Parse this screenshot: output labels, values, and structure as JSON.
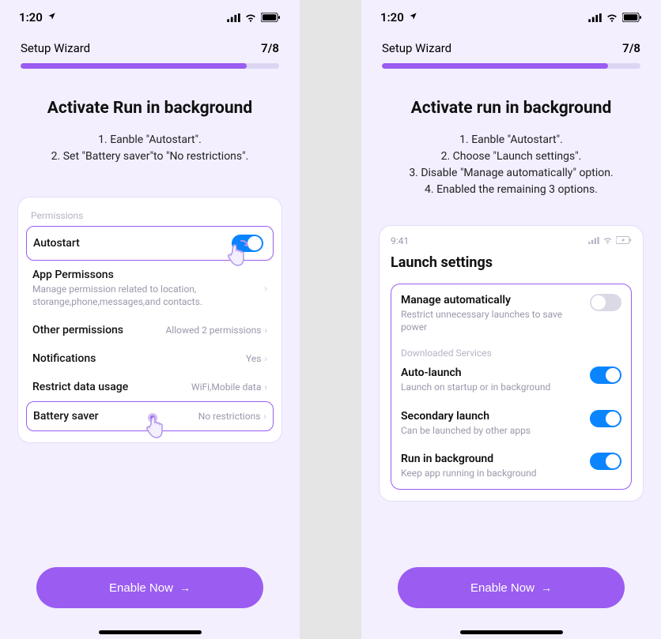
{
  "statusbar": {
    "time": "1:20"
  },
  "header": {
    "label": "Setup Wizard",
    "step": "7/8"
  },
  "left": {
    "title": "Activate Run in background",
    "instructions": [
      "1.  Eanble \"Autostart\".",
      "2.  Set \"Battery saver\"to \"No restrictions\"."
    ],
    "card": {
      "section": "Permissions",
      "autostart": {
        "label": "Autostart"
      },
      "apppermissions": {
        "label": "App Permissons",
        "sub": "Manage permission related to location, storange,phone,messages,and contacts."
      },
      "otherperm": {
        "label": "Other permissions",
        "value": "Allowed 2 permissions"
      },
      "notifications": {
        "label": "Notifications",
        "value": "Yes"
      },
      "restrictdata": {
        "label": "Restrict data usage",
        "value": "WiFi,Mobile data"
      },
      "batterysaver": {
        "label": "Battery saver",
        "value": "No restrictions"
      }
    }
  },
  "right": {
    "title": "Activate run in background",
    "instructions": [
      "1.  Eanble \"Autostart\".",
      "2.  Choose \"Launch settings\".",
      "3.  Disable \"Manage automatically\" option.",
      "4.  Enabled the remaining 3 options."
    ],
    "inner": {
      "time": "9:41",
      "title": "Launch settings",
      "manage": {
        "label": "Manage automatically",
        "sub": "Restrict unnecessary launches to save power"
      },
      "dl": "Downloaded Services",
      "autolaunch": {
        "label": "Auto-launch",
        "sub": "Launch on startup or in background"
      },
      "secondary": {
        "label": "Secondary launch",
        "sub": "Can be launched by other apps"
      },
      "runbg": {
        "label": "Run in background",
        "sub": "Keep app running in background"
      }
    }
  },
  "cta": "Enable Now"
}
